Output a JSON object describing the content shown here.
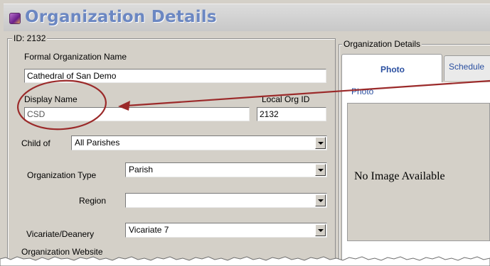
{
  "window": {
    "title": "Organization Details"
  },
  "left_group": {
    "legend": "ID: 2132"
  },
  "fields": {
    "formal_name": {
      "label": "Formal Organization Name",
      "value": "Cathedral of San Demo"
    },
    "display_name": {
      "label": "Display Name",
      "value": "CSD"
    },
    "local_org_id": {
      "label": "Local Org ID",
      "value": "2132"
    },
    "child_of": {
      "label": "Child of",
      "value": "All Parishes"
    },
    "org_type": {
      "label": "Organization Type",
      "value": "Parish"
    },
    "region": {
      "label": "Region",
      "value": ""
    },
    "vicariate": {
      "label": "Vicariate/Deanery",
      "value": "Vicariate 7"
    },
    "website": {
      "label": "Organization Website"
    }
  },
  "right_group": {
    "legend": "Organization Details",
    "tabs": [
      {
        "label": "Photo",
        "active": true
      },
      {
        "label": "Schedule",
        "active": false
      }
    ],
    "photo_legend": "Photo",
    "no_image_text": "No Image Available"
  },
  "annotation": {
    "circle_color": "#9b2a2a",
    "arrow_color": "#9b2a2a"
  }
}
